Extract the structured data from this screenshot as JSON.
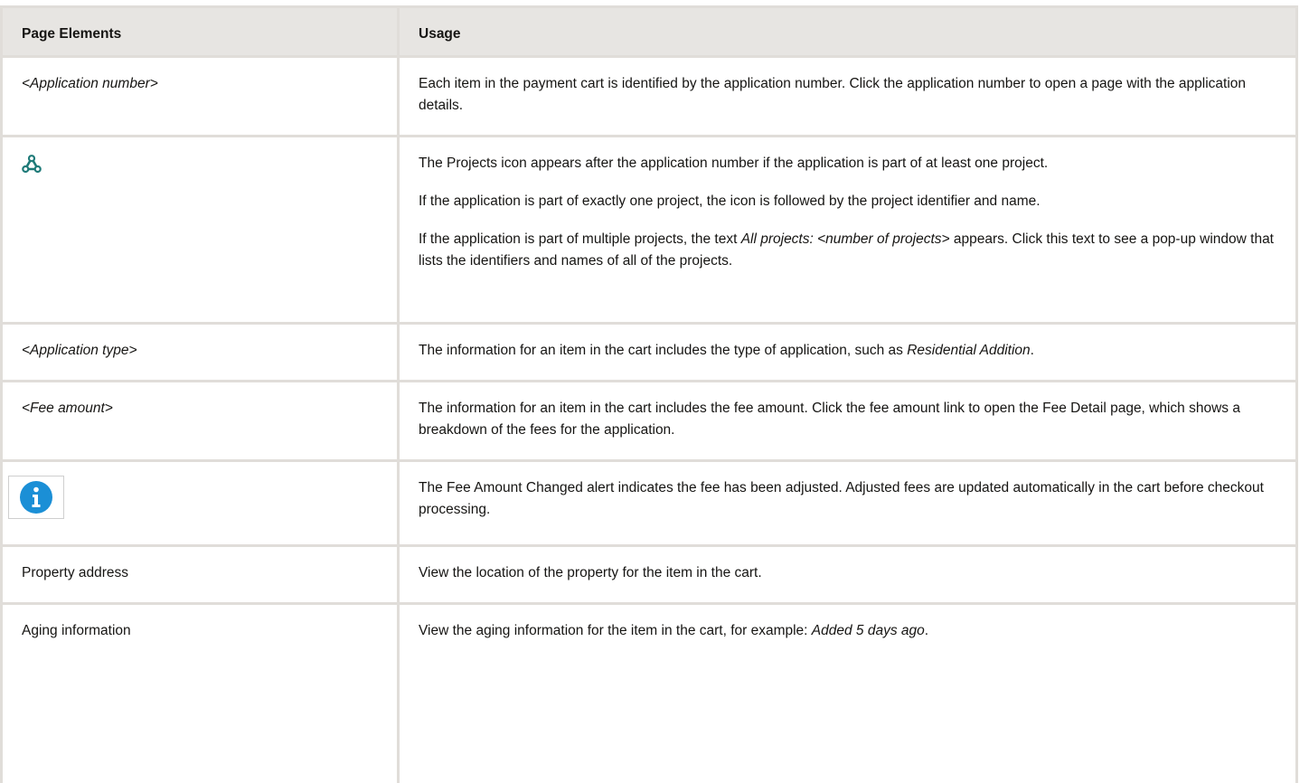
{
  "table": {
    "headers": {
      "elements": "Page Elements",
      "usage": "Usage"
    },
    "rows": [
      {
        "element": "<Application number>",
        "usage": [
          "Each item in the payment cart is identified by the application number. Click the application number to open a page with the application details."
        ]
      },
      {
        "element_icon": "projects-icon",
        "usage": [
          "The Projects icon appears after the application number if the application is part of at least one project.",
          "If the application is part of exactly one project, the icon is followed by the project identifier and name."
        ],
        "usage_p3": {
          "pre": "If the application is part of multiple projects, the text ",
          "em": "All projects: <number of projects>",
          "post": " appears. Click this text to see a pop-up window that lists the identifiers and names of all of the projects."
        }
      },
      {
        "element": "<Application type>",
        "usage_rich": {
          "pre": "The information for an item in the cart includes the type of application, such as ",
          "em": "Residential Addition",
          "post": "."
        }
      },
      {
        "element": "<Fee amount>",
        "usage": [
          "The information for an item in the cart includes the fee amount. Click the fee amount link to open the Fee Detail page, which shows a breakdown of the fees for the application."
        ]
      },
      {
        "element_icon": "info-icon",
        "usage": [
          "The Fee Amount Changed alert indicates the fee has been adjusted. Adjusted fees are updated automatically in the cart before checkout processing."
        ]
      },
      {
        "element": "Property address",
        "usage": [
          "View the location of the property for the item in the cart."
        ]
      },
      {
        "element": "Aging information",
        "usage_rich": {
          "pre": "View the aging information for the item in the cart, for example: ",
          "em": "Added 5 days ago",
          "post": "."
        }
      }
    ]
  },
  "colors": {
    "header_bg": "#e7e5e2",
    "border": "#e0ddd9",
    "projects_icon": "#1e7a78",
    "info_icon": "#1b8fd6"
  }
}
